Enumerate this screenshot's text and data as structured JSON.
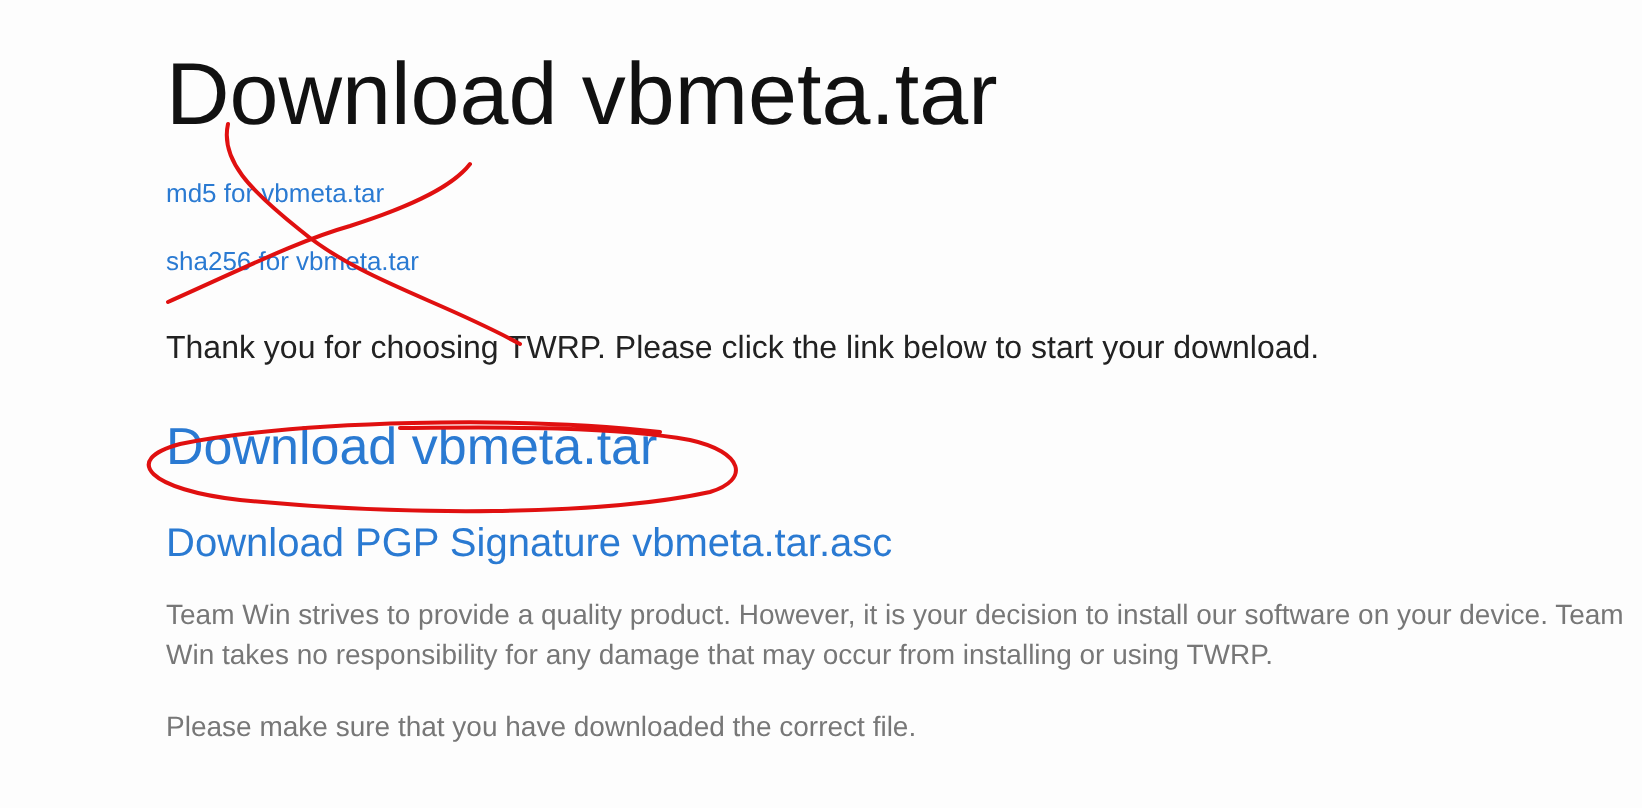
{
  "title": "Download vbmeta.tar",
  "checksum_links": [
    "md5 for vbmeta.tar",
    "sha256 for vbmeta.tar"
  ],
  "thanks": "Thank you for choosing TWRP. Please click the link below to start your download.",
  "download_link": "Download vbmeta.tar",
  "signature_link": "Download PGP Signature vbmeta.tar.asc",
  "notes": [
    "Team Win strives to provide a quality product. However, it is your decision to install our software on your device. Team Win takes no responsibility for any damage that may occur from installing or using TWRP.",
    "Please make sure that you have downloaded the correct file."
  ]
}
